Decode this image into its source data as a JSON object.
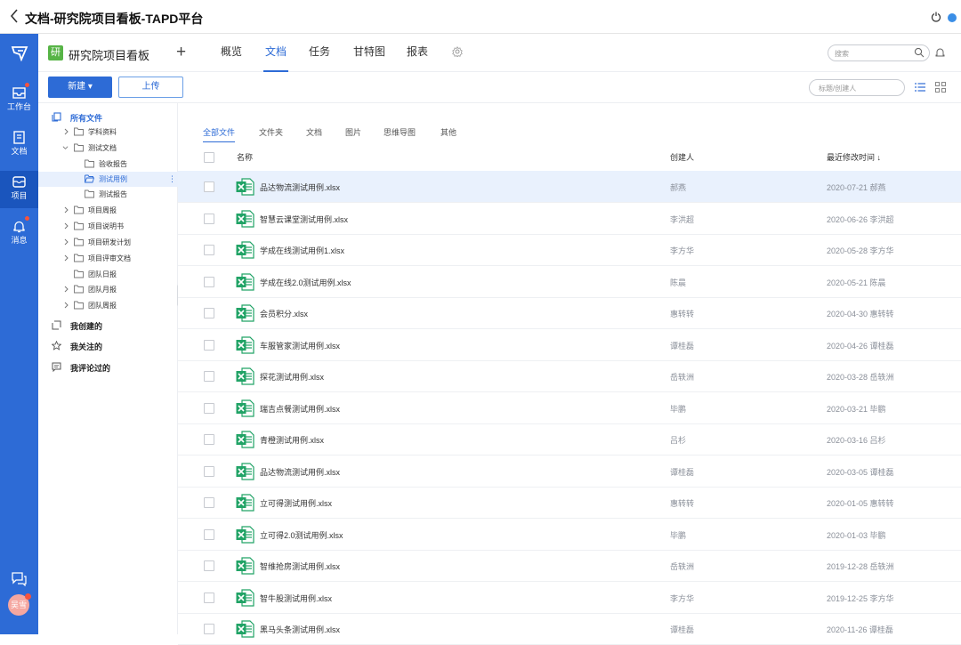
{
  "window": {
    "title": "文档-研究院项目看板-TAPD平台"
  },
  "rail": {
    "items": [
      {
        "label": "工作台",
        "icon": "inbox-tray-icon",
        "badge": true
      },
      {
        "label": "文档",
        "icon": "document-icon",
        "badge": false
      },
      {
        "label": "项目",
        "icon": "project-box-icon",
        "badge": false,
        "active": true
      },
      {
        "label": "消息",
        "icon": "bell-icon",
        "badge": true
      }
    ],
    "avatar_text": "吴雪"
  },
  "project": {
    "badge": "研",
    "name": "研究院项目看板",
    "tabs": [
      "概览",
      "文档",
      "任务",
      "甘特图",
      "报表"
    ],
    "active_tab": "文档",
    "search_placeholder": "搜索"
  },
  "toolbar": {
    "new_label": "新建 ▾",
    "upload_label": "上传",
    "filter_placeholder": "标题/创建人"
  },
  "tree": {
    "all_files": "所有文件",
    "nodes": [
      {
        "label": "学科资料",
        "level": 1,
        "chevron": "right"
      },
      {
        "label": "测试文档",
        "level": 1,
        "chevron": "down"
      },
      {
        "label": "验收报告",
        "level": 2,
        "chevron": "none"
      },
      {
        "label": "测试用例",
        "level": 2,
        "chevron": "none",
        "selected": true
      },
      {
        "label": "测试报告",
        "level": 2,
        "chevron": "none"
      },
      {
        "label": "项目周报",
        "level": 1,
        "chevron": "right"
      },
      {
        "label": "项目说明书",
        "level": 1,
        "chevron": "right"
      },
      {
        "label": "项目研发计划",
        "level": 1,
        "chevron": "right"
      },
      {
        "label": "项目评审文档",
        "level": 1,
        "chevron": "right"
      },
      {
        "label": "团队日报",
        "level": 1,
        "chevron": "none"
      },
      {
        "label": "团队月报",
        "level": 1,
        "chevron": "right"
      },
      {
        "label": "团队周报",
        "level": 1,
        "chevron": "right"
      }
    ],
    "sections": [
      "我创建的",
      "我关注的",
      "我评论过的"
    ]
  },
  "filter_tabs": [
    "全部文件",
    "文件夹",
    "文档",
    "图片",
    "思维导图",
    "其他"
  ],
  "active_filter_tab": "全部文件",
  "table": {
    "col_name": "名称",
    "col_creator": "创建人",
    "col_modified": "最近修改时间 ↓",
    "rows": [
      {
        "name": "品达物流测试用例.xlsx",
        "creator": "郝燕",
        "date": "2020-07-21  郝燕"
      },
      {
        "name": "智慧云课堂测试用例.xlsx",
        "creator": "李洪超",
        "date": "2020-06-26  李洪超"
      },
      {
        "name": "学成在线测试用例1.xlsx",
        "creator": "李方华",
        "date": "2020-05-28  李方华"
      },
      {
        "name": "学成在线2.0测试用例.xlsx",
        "creator": "陈晨",
        "date": "2020-05-21  陈晨"
      },
      {
        "name": "会员积分.xlsx",
        "creator": "惠转转",
        "date": "2020-04-30  惠转转"
      },
      {
        "name": "车服管家测试用例.xlsx",
        "creator": "谭桂磊",
        "date": "2020-04-26  谭桂磊"
      },
      {
        "name": "探花测试用例.xlsx",
        "creator": "岳轶洲",
        "date": "2020-03-28  岳轶洲"
      },
      {
        "name": "瑞吉点餐测试用例.xlsx",
        "creator": "毕鹏",
        "date": "2020-03-21  毕鹏"
      },
      {
        "name": "青橙测试用例.xlsx",
        "creator": "吕杉",
        "date": "2020-03-16  吕杉"
      },
      {
        "name": "品达物流测试用例.xlsx",
        "creator": "谭桂磊",
        "date": "2020-03-05  谭桂磊"
      },
      {
        "name": "立可得测试用例.xlsx",
        "creator": "惠转转",
        "date": "2020-01-05  惠转转"
      },
      {
        "name": "立可得2.0测试用例.xlsx",
        "creator": "毕鹏",
        "date": "2020-01-03  毕鹏"
      },
      {
        "name": "智维抢房测试用例.xlsx",
        "creator": "岳轶洲",
        "date": "2019-12-28  岳轶洲"
      },
      {
        "name": "智牛股测试用例.xlsx",
        "creator": "李方华",
        "date": "2019-12-25  李方华"
      },
      {
        "name": "黑马头条测试用例.xlsx",
        "creator": "谭桂磊",
        "date": "2020-11-26  谭桂磊"
      }
    ]
  },
  "colors": {
    "brand": "#2d6bd6",
    "excel": "#21a366",
    "badge": "#f5533d"
  }
}
